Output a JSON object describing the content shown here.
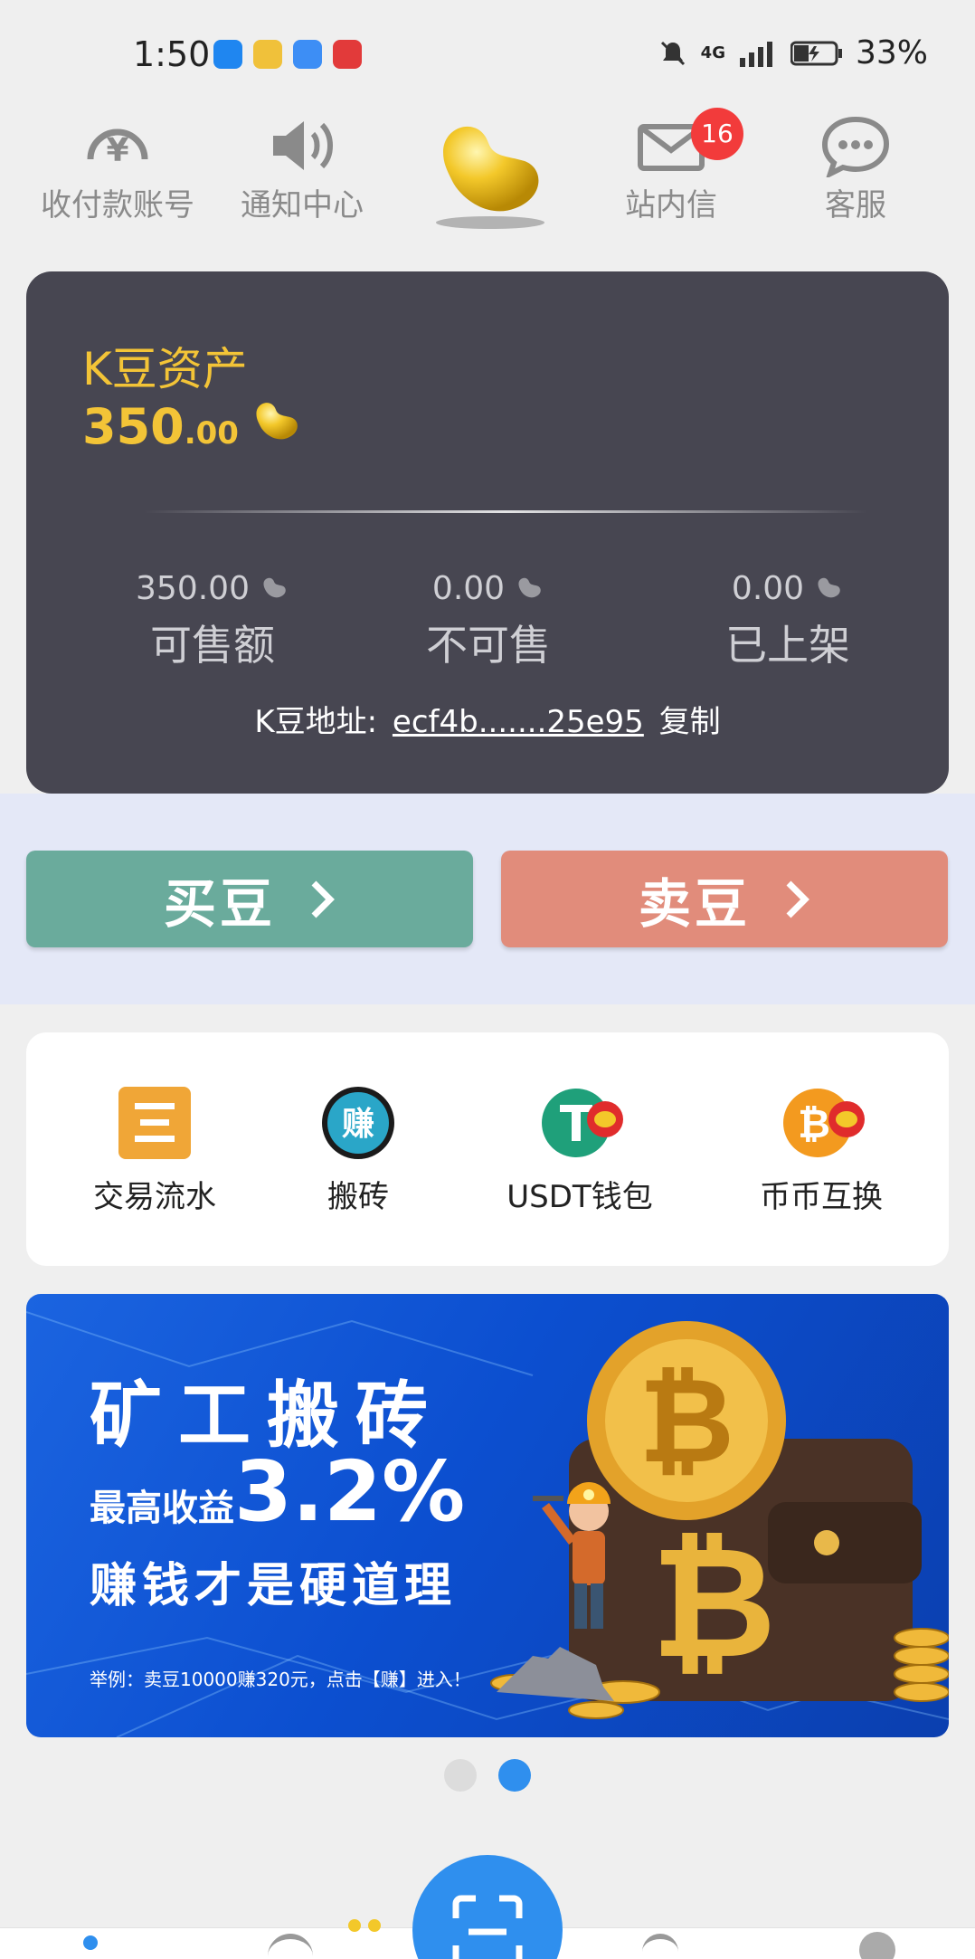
{
  "status_bar": {
    "time": "1:50",
    "network": "4G",
    "battery": "33%"
  },
  "top_nav": [
    {
      "label": "收付款账号",
      "icon": "yen-circle-icon"
    },
    {
      "label": "通知中心",
      "icon": "speaker-icon"
    },
    {
      "label": "站内信",
      "icon": "mail-icon",
      "badge": "16"
    },
    {
      "label": "客服",
      "icon": "chat-bubble-icon"
    }
  ],
  "asset_card": {
    "title": "K豆资产",
    "value_int": "350",
    "value_dec": ".00",
    "stats": [
      {
        "value": "350.00",
        "label": "可售额"
      },
      {
        "value": "0.00",
        "label": "不可售"
      },
      {
        "value": "0.00",
        "label": "已上架"
      }
    ],
    "address_label": "K豆地址:",
    "address_value": "ecf4b.......25e95",
    "copy_label": "复制"
  },
  "actions": {
    "buy_label": "买豆",
    "sell_label": "卖豆"
  },
  "quick_functions": [
    {
      "label": "交易流水",
      "icon": "ledger-icon"
    },
    {
      "label": "搬砖",
      "icon": "earn-icon",
      "icon_text": "赚"
    },
    {
      "label": "USDT钱包",
      "icon": "usdt-icon"
    },
    {
      "label": "币币互换",
      "icon": "bitcoin-swap-icon"
    }
  ],
  "banner": {
    "line1": "矿工搬砖",
    "line2_small": "最高收益",
    "line2_big": "3.2%",
    "line3": "赚钱才是硬道理",
    "line4": "举例：卖豆10000赚320元，点击【赚】进入！"
  },
  "carousel": {
    "total": 2,
    "active": 2
  },
  "colors": {
    "card_bg": "#474651",
    "gold": "#f3c437",
    "buy": "#6aab9c",
    "sell": "#e18c7b",
    "accent_blue": "#2f8fee",
    "badge_red": "#f23b3b"
  }
}
